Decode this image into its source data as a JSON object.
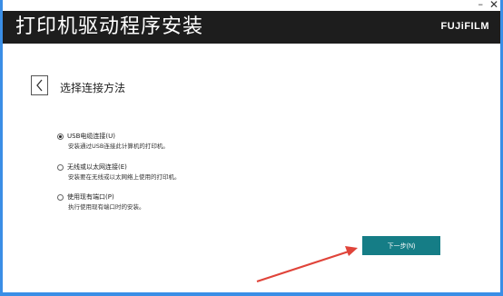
{
  "window": {
    "minimize_glyph": "–",
    "close_glyph": "✕"
  },
  "header": {
    "title": "打印机驱动程序安装",
    "logo": "FUJiFILM"
  },
  "page": {
    "title": "选择连接方法",
    "back_icon": "chevron-left-icon"
  },
  "options": [
    {
      "label": "USB电缆连接(U)",
      "description": "安装通过USB连接此计算机的打印机。",
      "selected": true
    },
    {
      "label": "无线或以太网连接(E)",
      "description": "安装要在无线或以太网络上使用的打印机。",
      "selected": false
    },
    {
      "label": "使用现有端口(P)",
      "description": "执行使用现有端口时的安装。",
      "selected": false
    }
  ],
  "buttons": {
    "next": "下一步(N)"
  },
  "colors": {
    "header_bg": "#1d1d1d",
    "accent": "#157d86",
    "window_border": "#3a8ee6",
    "annotation_arrow": "#e0443a"
  }
}
